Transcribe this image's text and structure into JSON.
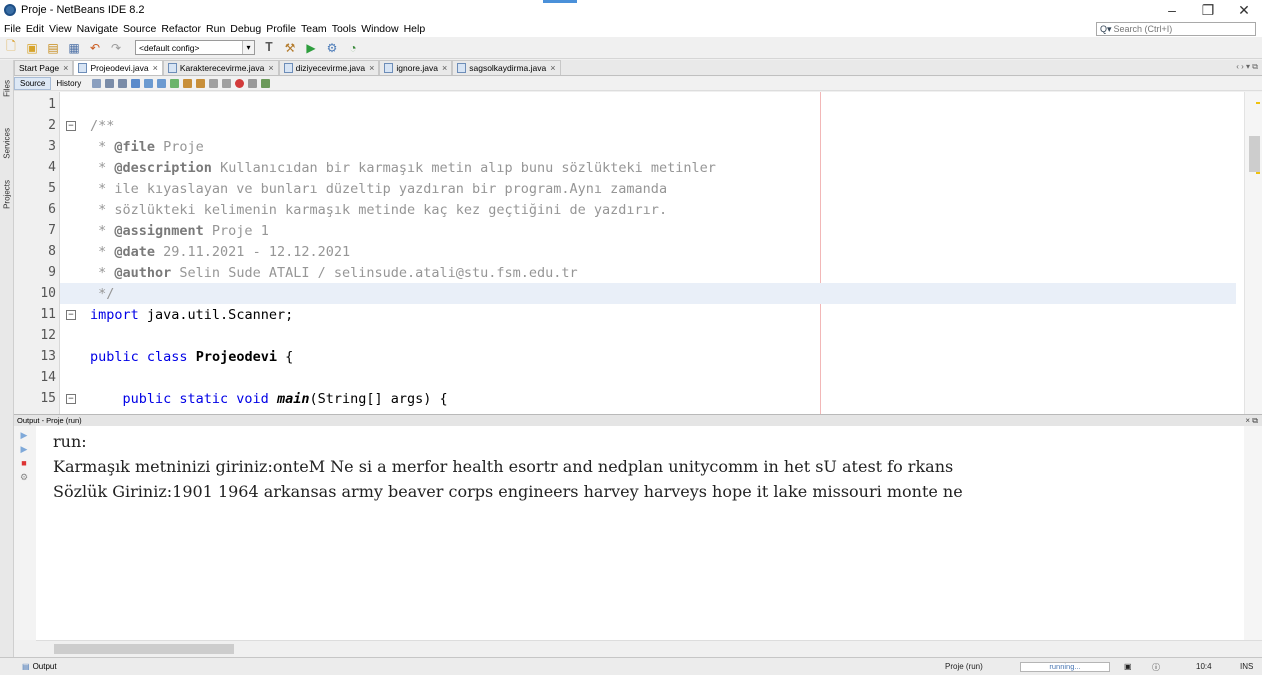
{
  "window": {
    "title": "Proje - NetBeans IDE 8.2",
    "controls": [
      "–",
      "❐",
      "✕"
    ]
  },
  "menubar": [
    "File",
    "Edit",
    "View",
    "Navigate",
    "Source",
    "Refactor",
    "Run",
    "Debug",
    "Profile",
    "Team",
    "Tools",
    "Window",
    "Help"
  ],
  "search": {
    "placeholder": "Search (Ctrl+I)"
  },
  "toolbar": {
    "config": "<default config>"
  },
  "side_tabs": [
    "Files",
    "Services",
    "Projects"
  ],
  "tabs": [
    {
      "label": "Start Page",
      "active": false
    },
    {
      "label": "Projeodevi.java",
      "active": true
    },
    {
      "label": "Karakterecevirme.java",
      "active": false
    },
    {
      "label": "diziyecevirme.java",
      "active": false
    },
    {
      "label": "ignore.java",
      "active": false
    },
    {
      "label": "sagsolkaydirma.java",
      "active": false
    }
  ],
  "editor_tabs": {
    "source": "Source",
    "history": "History"
  },
  "code_lines": [
    {
      "n": "1",
      "text": ""
    },
    {
      "n": "2",
      "text": "/**"
    },
    {
      "n": "3",
      "tag": "@file",
      "text": " Proje"
    },
    {
      "n": "4",
      "tag": "@description",
      "text": " Kullanıcıdan bir karmaşık metin alıp bunu sözlükteki metinler"
    },
    {
      "n": "5",
      "text": " * ile kıyaslayan ve bunları düzeltip yazdıran bir program.Aynı zamanda"
    },
    {
      "n": "6",
      "text": " * sözlükteki kelimenin karmaşık metinde kaç kez geçtiğini de yazdırır."
    },
    {
      "n": "7",
      "tag": "@assignment",
      "text": " Proje 1"
    },
    {
      "n": "8",
      "tag": "@date",
      "text": " 29.11.2021 - 12.12.2021"
    },
    {
      "n": "9",
      "tag": "@author",
      "text": " Selin Sude ATALI / selinsude.atali@stu.fsm.edu.tr"
    },
    {
      "n": "10",
      "text": " */"
    },
    {
      "n": "11",
      "kw": "import",
      "text": " java.util.Scanner;"
    },
    {
      "n": "12",
      "text": ""
    },
    {
      "n": "13",
      "kw": "public class",
      "bold": "Projeodevi",
      "text": " {"
    },
    {
      "n": "14",
      "text": ""
    },
    {
      "n": "15",
      "kw": "public static void",
      "ital": "main",
      "text": "(String[] args) {"
    }
  ],
  "output": {
    "header": "Output - Proje (run)",
    "lines": [
      "run:",
      "Karmaşık metninizi giriniz:onteM Ne si a merfor health esortr and nedplan unitycomm in het sU atest fo rkans",
      "Sözlük Giriniz:1901 1964 arkansas army beaver corps engineers harvey harveys hope it lake missouri monte ne"
    ]
  },
  "status": {
    "output_tab": "Output",
    "project": "Proje (run)",
    "progress_text": "running...",
    "position": "10:4",
    "mode": "INS"
  }
}
